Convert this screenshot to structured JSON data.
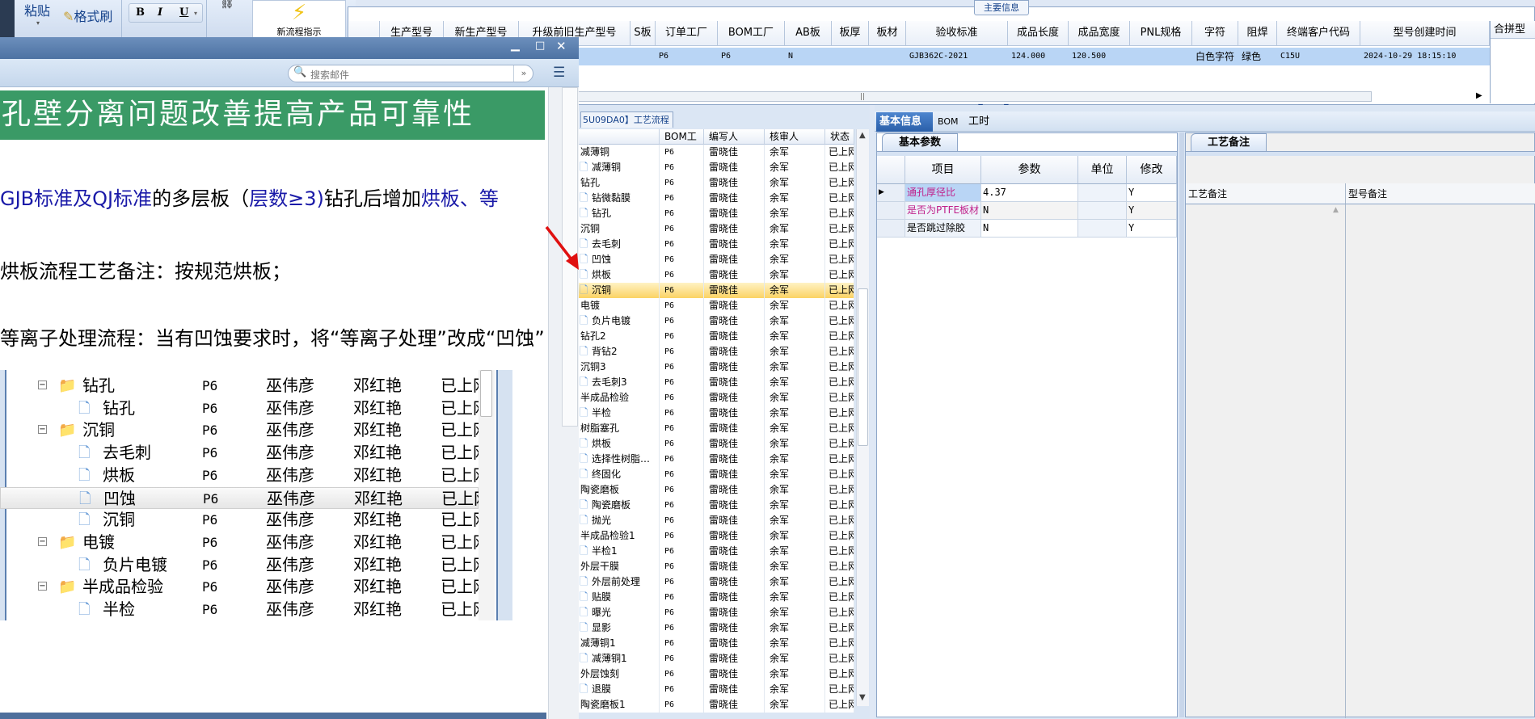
{
  "ribbon": {
    "paste": "粘贴",
    "format_painter": "格式刷",
    "bold": "B",
    "italic": "I",
    "underline": "U",
    "new_flow_button": "新流程指示"
  },
  "main_info": {
    "group_title": "主要信息",
    "columns": [
      "生产型号",
      "新生产型号",
      "升级前旧生产型号",
      "S板",
      "订单工厂",
      "BOM工厂",
      "AB板",
      "板厚",
      "板材",
      "验收标准",
      "成品长度",
      "成品宽度",
      "PNL规格",
      "字符",
      "阻焊",
      "终端客户代码",
      "型号创建时间"
    ],
    "row": [
      "",
      "",
      "",
      "",
      "P6",
      "P6",
      "N",
      "",
      "",
      "GJB362C-2021",
      "124.000",
      "120.500",
      "",
      "白色字符",
      "绿色",
      "C15U",
      "2024-10-29 18:15:10"
    ],
    "side_column": "合拼型"
  },
  "email": {
    "search_placeholder": "搜索邮件",
    "banner": "孔壁分离问题改善提高产品可靠性",
    "line1": [
      {
        "t": "GJB标准及QJ标准",
        "c": "blue"
      },
      {
        "t": "的多层板（",
        "c": ""
      },
      {
        "t": "层数≥3)",
        "c": "blue"
      },
      {
        "t": "钻孔后增加",
        "c": ""
      },
      {
        "t": "烘板、等",
        "c": "blue"
      }
    ],
    "line2": "烘板流程工艺备注：按规范烘板；",
    "line3": "等离子处理流程：当有凹蚀要求时，将“等离子处理”改成“凹蚀”",
    "image_rows": [
      {
        "name": "钻孔",
        "level": 0,
        "factory": "P6",
        "writer": "巫伟彦",
        "reviewer": "邓红艳",
        "status": "已上网"
      },
      {
        "name": "钻孔",
        "level": 1,
        "factory": "P6",
        "writer": "巫伟彦",
        "reviewer": "邓红艳",
        "status": "已上网"
      },
      {
        "name": "沉铜",
        "level": 0,
        "factory": "P6",
        "writer": "巫伟彦",
        "reviewer": "邓红艳",
        "status": "已上网"
      },
      {
        "name": "去毛刺",
        "level": 1,
        "factory": "P6",
        "writer": "巫伟彦",
        "reviewer": "邓红艳",
        "status": "已上网"
      },
      {
        "name": "烘板",
        "level": 1,
        "factory": "P6",
        "writer": "巫伟彦",
        "reviewer": "邓红艳",
        "status": "已上网"
      },
      {
        "name": "凹蚀",
        "level": 1,
        "factory": "P6",
        "writer": "巫伟彦",
        "reviewer": "邓红艳",
        "status": "已上网",
        "selected": true
      },
      {
        "name": "沉铜",
        "level": 1,
        "factory": "P6",
        "writer": "巫伟彦",
        "reviewer": "邓红艳",
        "status": "已上网"
      },
      {
        "name": "电镀",
        "level": 0,
        "factory": "P6",
        "writer": "巫伟彦",
        "reviewer": "邓红艳",
        "status": "已上网"
      },
      {
        "name": "负片电镀",
        "level": 1,
        "factory": "P6",
        "writer": "巫伟彦",
        "reviewer": "邓红艳",
        "status": "已上网"
      },
      {
        "name": "半成品检验",
        "level": 0,
        "factory": "P6",
        "writer": "巫伟彦",
        "reviewer": "邓红艳",
        "status": "已上网"
      },
      {
        "name": "半检",
        "level": 1,
        "factory": "P6",
        "writer": "巫伟彦",
        "reviewer": "邓红艳",
        "status": "已上网"
      }
    ]
  },
  "process": {
    "tab": "5U09DA0】工艺流程",
    "columns": [
      "",
      "BOM工厂",
      "编写人",
      "核审人",
      "状态"
    ],
    "factory": "P6",
    "writer": "雷晓佳",
    "reviewer": "余军",
    "status": "已上网",
    "rows": [
      {
        "name": "减薄铜",
        "level": 0
      },
      {
        "name": "减薄铜",
        "level": 1
      },
      {
        "name": "钻孔",
        "level": 0
      },
      {
        "name": "钻微黏膜",
        "level": 1
      },
      {
        "name": "钻孔",
        "level": 1
      },
      {
        "name": "沉铜",
        "level": 0
      },
      {
        "name": "去毛刺",
        "level": 1
      },
      {
        "name": "凹蚀",
        "level": 1
      },
      {
        "name": "烘板",
        "level": 1
      },
      {
        "name": "沉铜",
        "level": 1,
        "selected": true
      },
      {
        "name": "电镀",
        "level": 0
      },
      {
        "name": "负片电镀",
        "level": 1
      },
      {
        "name": "钻孔2",
        "level": 0
      },
      {
        "name": "背钻2",
        "level": 1
      },
      {
        "name": "沉铜3",
        "level": 0
      },
      {
        "name": "去毛刺3",
        "level": 1
      },
      {
        "name": "半成品检验",
        "level": 0
      },
      {
        "name": "半检",
        "level": 1
      },
      {
        "name": "树脂塞孔",
        "level": 0
      },
      {
        "name": "烘板",
        "level": 1
      },
      {
        "name": "选择性树脂…",
        "level": 1
      },
      {
        "name": "终固化",
        "level": 1
      },
      {
        "name": "陶瓷磨板",
        "level": 0
      },
      {
        "name": "陶瓷磨板",
        "level": 1
      },
      {
        "name": "抛光",
        "level": 1
      },
      {
        "name": "半成品检验1",
        "level": 0
      },
      {
        "name": "半检1",
        "level": 1
      },
      {
        "name": "外层干膜",
        "level": 0
      },
      {
        "name": "外层前处理",
        "level": 1
      },
      {
        "name": "贴膜",
        "level": 1
      },
      {
        "name": "曝光",
        "level": 1
      },
      {
        "name": "显影",
        "level": 1
      },
      {
        "name": "减薄铜1",
        "level": 0
      },
      {
        "name": "减薄铜1",
        "level": 1
      },
      {
        "name": "外层蚀刻",
        "level": 0
      },
      {
        "name": "退膜",
        "level": 1
      },
      {
        "name": "陶瓷磨板1",
        "level": 0
      }
    ]
  },
  "detail": {
    "tabs": [
      "基本信息",
      "BOM",
      "工时"
    ],
    "active_tab": "基本信息",
    "param_tab": "基本参数",
    "param_columns": [
      "项目",
      "参数",
      "单位",
      "修改"
    ],
    "params": [
      {
        "item": "通孔厚径比",
        "value": "4.37",
        "unit": "",
        "modify": "Y",
        "highlight": true
      },
      {
        "item": "是否为PTFE板材",
        "value": "N",
        "unit": "",
        "modify": "Y",
        "highlight": true
      },
      {
        "item": "是否跳过除胶",
        "value": "N",
        "unit": "",
        "modify": "Y",
        "highlight": false
      }
    ],
    "memo_tab": "工艺备注",
    "memo_columns": [
      "工艺备注",
      "型号备注"
    ]
  },
  "colors": {
    "highlight_text": "#c0208a",
    "banner_green": "#3a9a66",
    "selected_row": "#fbd364",
    "link_blue": "#1a1aa8",
    "annotation_arrow": "#e01010"
  }
}
